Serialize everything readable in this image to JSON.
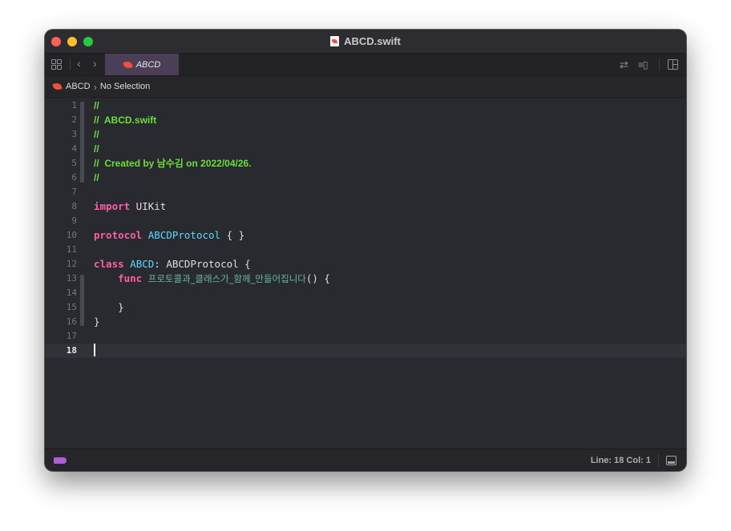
{
  "window": {
    "title": "ABCD.swift"
  },
  "tabbar": {
    "active_tab": "ABCD",
    "icons": [
      "grid-icon",
      "chevron-left-icon",
      "chevron-right-icon",
      "swap-icon",
      "lines-icon",
      "add-editor-icon"
    ]
  },
  "jumpbar": {
    "group": "ABCD",
    "selection": "No Selection"
  },
  "editor": {
    "current_line": 18,
    "lines": [
      {
        "n": "1",
        "text": "//"
      },
      {
        "n": "2",
        "text": "//  ABCD.swift"
      },
      {
        "n": "3",
        "text": "//"
      },
      {
        "n": "4",
        "text": "//"
      },
      {
        "n": "5",
        "text": "//  Created by 남수김 on 2022/04/26."
      },
      {
        "n": "6",
        "text": "//"
      },
      {
        "n": "7",
        "text": ""
      },
      {
        "n": "8",
        "text": "import UIKit"
      },
      {
        "n": "9",
        "text": ""
      },
      {
        "n": "10",
        "text": "protocol ABCDProtocol { }"
      },
      {
        "n": "11",
        "text": ""
      },
      {
        "n": "12",
        "text": "class ABCD: ABCDProtocol {"
      },
      {
        "n": "13",
        "text": "    func 프로토콜과_클래스가_함께_만들어집니다() {"
      },
      {
        "n": "14",
        "text": ""
      },
      {
        "n": "15",
        "text": "    }"
      },
      {
        "n": "16",
        "text": "}"
      },
      {
        "n": "17",
        "text": ""
      },
      {
        "n": "18",
        "text": ""
      }
    ],
    "tokens": {
      "l1": "//",
      "l2": "//  ABCD.swift",
      "l3": "//",
      "l4": "//",
      "l5": "//  Created by 남수김 on 2022/04/26.",
      "l6": "//",
      "l8_kw": "import",
      "l8_name": " UIKit",
      "l10_kw": "protocol",
      "l10_name": "ABCDProtocol",
      "l10_rest": " { }",
      "l12_kw": "class",
      "l12_name": "ABCD",
      "l12_colon": ": ",
      "l12_super": "ABCDProtocol",
      "l12_rest": " {",
      "l13_indent": "    ",
      "l13_kw": "func",
      "l13_name": "프로토콜과_클래스가_함께_만들어집니다",
      "l13_rest": "() {",
      "l15": "    }",
      "l16": "}"
    }
  },
  "statusbar": {
    "position": "Line: 18  Col: 1"
  },
  "colors": {
    "background": "#292a30",
    "comment": "#6bdf38",
    "keyword": "#fc5fa3",
    "type_decl": "#5dd8ff",
    "function": "#67b7a4",
    "tab_active": "#4a3f57",
    "tag": "#b05ddc"
  }
}
